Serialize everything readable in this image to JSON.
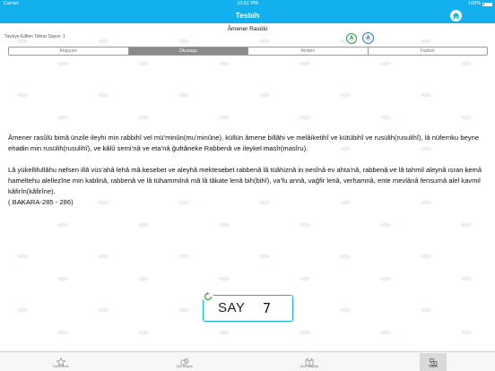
{
  "status_bar": {
    "carrier": "Carrier",
    "time": "10:52 PM",
    "battery": "100%"
  },
  "nav": {
    "title": "Tesbih"
  },
  "page": {
    "title": "Âmener Rasûlü",
    "repeat_count": "Tavsiye Edilen Tekrar Sayısı: 1"
  },
  "font_buttons": {
    "smaller": "A",
    "larger": "A"
  },
  "tabs_segment": [
    {
      "label": "Arapçası",
      "active": false
    },
    {
      "label": "Okunuşu",
      "active": true
    },
    {
      "label": "Anlamı",
      "active": false
    },
    {
      "label": "Fazileti",
      "active": false
    }
  ],
  "text": {
    "paragraph1": "Âmener rasûlü bimâ ünzile ileyhi min rabbihî vel mü’minûn(mu’minûne), küllün âmene billâhi ve melâiketihî ve kütübihî ve rusülih(rusulihî), lâ nüferriku beyne ehadin min rusülih(rusulihî), ve kâlû semi’nâ ve eta’nâ ğufrâneke Rabbenâ ve ileykel masîr(masîru).",
    "paragraph2": "Lâ yükellifullâhu nefsen illâ vüs’ahâ lehâ mâ kesebet ve aleyhâ mektesebet rabbenâ lâ tüâhiznâ in nesînâ ev ahta’nâ, rabbenâ ve lâ tahmil aleynâ ısran kemâ hameltehu alellezîne min kablinâ, rabbenâ ve lâ tühammilnâ mâ lâ tâkate lenâ bih(bihî), va’fu annâ, vağfir lenâ, verhamnâ, ente mevlânâ fensurnâ alel kavmil kâfirîn(kâfirîne).",
    "reference": "( BAKARA-285 - 286)"
  },
  "counter": {
    "label": "SAY",
    "count": "7"
  },
  "bottom_tabs": [
    {
      "label": "Favorilerim",
      "icon": "star-icon",
      "active": false
    },
    {
      "label": "Şifa Duaları",
      "icon": "medicine-icon",
      "active": false
    },
    {
      "label": "Dua Kitaplığı",
      "icon": "book-icon",
      "active": false
    },
    {
      "label": "Tesbih",
      "icon": "tesbih-icon",
      "active": true
    }
  ],
  "colors": {
    "header": "#12b0ee",
    "segment_active": "#8a8a8a",
    "counter_border": "#12b0ee"
  }
}
